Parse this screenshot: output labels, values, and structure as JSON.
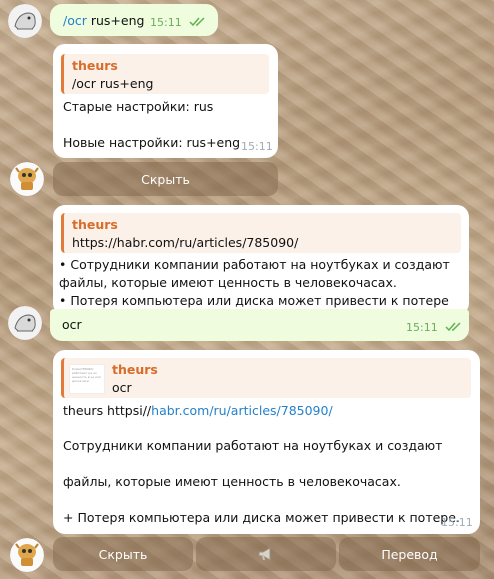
{
  "messages": {
    "m1": {
      "command": "/ocr",
      "args": " rus+eng",
      "time": "15:11"
    },
    "m2": {
      "reply_author": "theurs",
      "reply_text": "/ocr rus+eng",
      "line1": "Старые настройки: rus",
      "line2": "Новые настройки: rus+eng",
      "time": "15:11"
    },
    "kb1": {
      "hide": "Скрыть"
    },
    "m3": {
      "reply_author": "theurs",
      "reply_text": "https://habr.com/ru/articles/785090/",
      "lines": [
        "• Сотрудники компании работают на ноутбуках и создают",
        "файлы, которые имеют ценность в человекочасах.",
        "• Потеря компьютера или диска может привести к потере"
      ],
      "text": "ocr",
      "time": "15:11"
    },
    "m4": {
      "reply_author": "theurs",
      "reply_text": "ocr",
      "link_prefix": "theurs httpsi//",
      "link": "habr.com/ru/articles/785090/",
      "line2": "Сотрудники компании работают на ноутбуках и создают",
      "line3": "файлы, которые имеют ценность в человекочасах.",
      "line4": "+ Потеря компьютера или диска может привести к потере.",
      "time": "15:11",
      "thumb_text": "ticles/785090/ работают на но ценность в че или диска мож"
    },
    "kb2": {
      "hide": "Скрыть",
      "translate": "Перевод"
    }
  },
  "colors": {
    "accent": "#2481cc",
    "outgoing": "#effdde",
    "incoming": "#ffffff",
    "quote_name": "#d86c2a"
  }
}
